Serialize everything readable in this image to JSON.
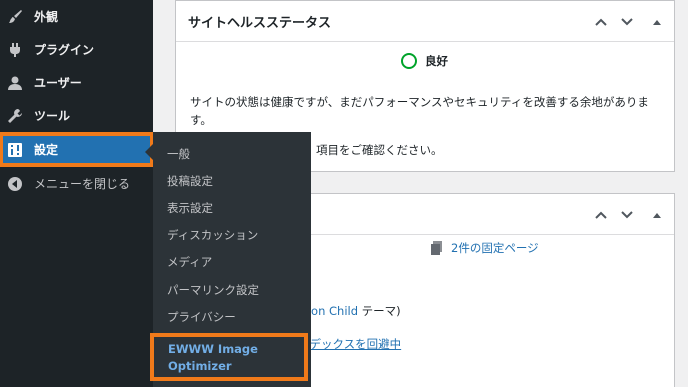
{
  "sidebar": {
    "items": [
      {
        "label": "外観",
        "icon": "paintbrush-icon"
      },
      {
        "label": "プラグイン",
        "icon": "plugin-icon"
      },
      {
        "label": "ユーザー",
        "icon": "user-icon"
      },
      {
        "label": "ツール",
        "icon": "wrench-icon"
      },
      {
        "label": "設定",
        "icon": "settings-icon"
      },
      {
        "label": "メニューを閉じる",
        "icon": "collapse-icon"
      }
    ]
  },
  "settings_submenu": {
    "items": [
      "一般",
      "投稿設定",
      "表示設定",
      "ディスカッション",
      "メディア",
      "パーマリンク設定",
      "プライバシー"
    ],
    "highlighted_line1": "EWWW Image",
    "highlighted_line2": "Optimizer"
  },
  "site_health": {
    "title": "サイトヘルスステータス",
    "status": "良好",
    "message_line1": "サイトの状態は健康ですが、まだパフォーマンスやセキュリティを改善する余地がありま",
    "message_line2": "す。",
    "message_line3": "項目をご確認ください。"
  },
  "glance": {
    "pages_link": "2件の固定ページ",
    "theme_link_fragment": "oon Child",
    "theme_suffix": " テーマ)",
    "index_link_fragment": "ンデックスを回避中"
  },
  "colors": {
    "sidebar_bg": "#1d2327",
    "active_blue": "#2271b1",
    "highlight_orange": "#f07a1a",
    "good_green": "#00a32a"
  }
}
